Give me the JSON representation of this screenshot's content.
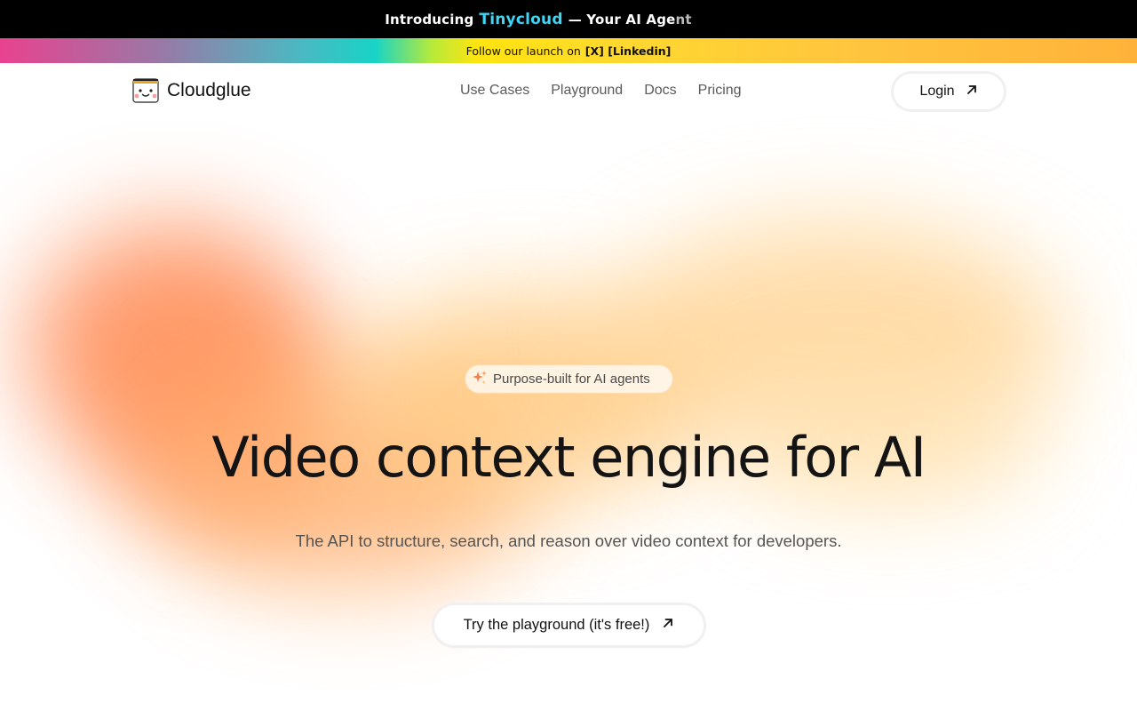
{
  "announcement": {
    "prefix": "Introducing",
    "brand": "Tinycloud",
    "suffix": "— Your AI Agent",
    "brand_color": "#3fd6f5"
  },
  "follow_bar": {
    "text": "Follow our launch on",
    "links": [
      "[X]",
      "[Linkedin]"
    ]
  },
  "nav": {
    "logo_text": "Cloudglue",
    "links": [
      "Use Cases",
      "Playground",
      "Docs",
      "Pricing"
    ],
    "login_label": "Login",
    "login_icon": "arrow-up-right-icon"
  },
  "hero": {
    "badge_icon": "sparkle-icon",
    "badge_text": "Purpose-built for AI agents",
    "headline": "Video context engine for AI",
    "subheadline": "The API to structure, search, and reason over video context for developers.",
    "cta_label": "Try the playground (it's free!)",
    "cta_icon": "arrow-up-right-icon"
  },
  "colors": {
    "accent_orange": "#ff8a55",
    "accent_yellow": "#ffd08a",
    "announce_bg": "#000000"
  }
}
